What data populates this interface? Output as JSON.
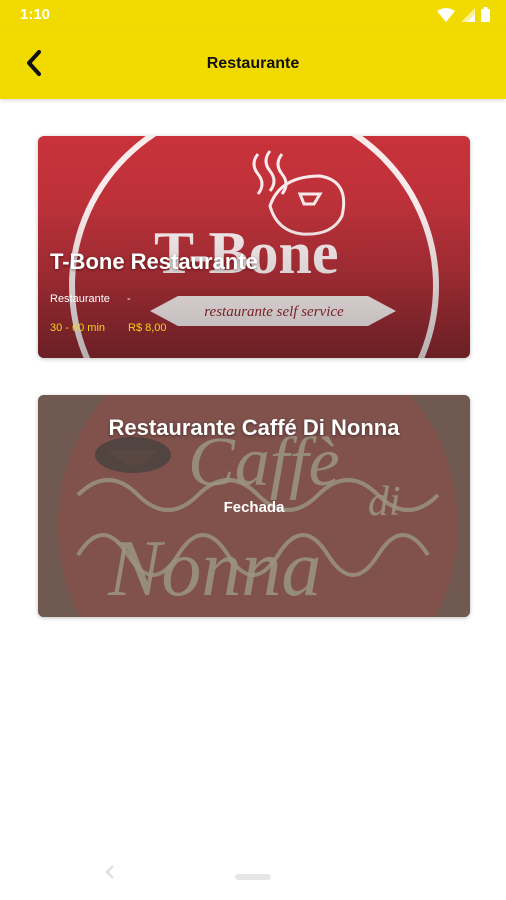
{
  "status_bar": {
    "time": "1:10"
  },
  "app_bar": {
    "title": "Restaurante"
  },
  "restaurants": [
    {
      "name": "T-Bone Restaurante",
      "category": "Restaurante",
      "separator": "-",
      "delivery_time": "30 - 60 min",
      "delivery_fee": "R$ 8,00",
      "logo_text": "T-Bone",
      "logo_subtext": "restaurante self service"
    },
    {
      "name": "Restaurante Caffé Di Nonna",
      "status": "Fechada",
      "logo_text_1": "Caffè",
      "logo_text_2": "di",
      "logo_text_3": "Nonna"
    }
  ],
  "colors": {
    "app_bar": "#f0da00",
    "accent_price": "#f2d21b",
    "card1_bg": "#c9323a",
    "card2_bg": "#7a5b4a"
  },
  "icons": {
    "back": "chevron-left-icon",
    "wifi": "wifi-icon",
    "signal": "signal-icon",
    "battery": "battery-icon"
  }
}
